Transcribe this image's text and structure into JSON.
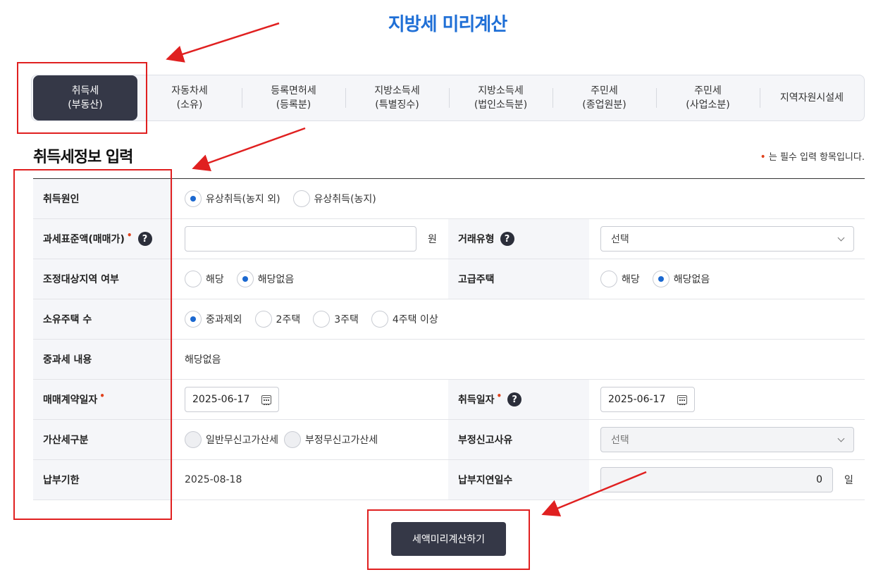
{
  "title": "지방세 미리계산",
  "tabs": [
    {
      "line1": "취득세",
      "line2": "(부동산)",
      "active": true
    },
    {
      "line1": "자동차세",
      "line2": "(소유)"
    },
    {
      "line1": "등록면허세",
      "line2": "(등록분)"
    },
    {
      "line1": "지방소득세",
      "line2": "(특별징수)"
    },
    {
      "line1": "지방소득세",
      "line2": "(법인소득분)"
    },
    {
      "line1": "주민세",
      "line2": "(종업원분)"
    },
    {
      "line1": "주민세",
      "line2": "(사업소분)"
    },
    {
      "line1": "지역자원시설세",
      "line2": ""
    }
  ],
  "section": {
    "title": "취득세정보 입력",
    "required_note": "는 필수 입력 항목입니다.",
    "required_mark": "•"
  },
  "form": {
    "cause": {
      "label": "취득원인",
      "options": [
        "유상취득(농지 외)",
        "유상취득(농지)"
      ],
      "selected": 0
    },
    "tax_base": {
      "label": "과세표준액(매매가)",
      "help": "?",
      "value": "",
      "unit": "원"
    },
    "deal_type": {
      "label": "거래유형",
      "help": "?",
      "value": "선택"
    },
    "adjust_area": {
      "label": "조정대상지역 여부",
      "options": [
        "해당",
        "해당없음"
      ],
      "selected": 1
    },
    "luxury": {
      "label": "고급주택",
      "options": [
        "해당",
        "해당없음"
      ],
      "selected": 1
    },
    "houses": {
      "label": "소유주택 수",
      "options": [
        "중과제외",
        "2주택",
        "3주택",
        "4주택 이상"
      ],
      "selected": 0
    },
    "heavy": {
      "label": "중과세 내용",
      "value": "해당없음"
    },
    "contract_date": {
      "label": "매매계약일자",
      "value": "2025-06-17"
    },
    "acq_date": {
      "label": "취득일자",
      "help": "?",
      "value": "2025-06-17"
    },
    "penalty": {
      "label": "가산세구분",
      "options": [
        "일반무신고가산세",
        "부정무신고가산세"
      ]
    },
    "fraud_reason": {
      "label": "부정신고사유",
      "value": "선택"
    },
    "due": {
      "label": "납부기한",
      "value": "2025-08-18"
    },
    "late_days": {
      "label": "납부지연일수",
      "value": "0",
      "unit": "일"
    }
  },
  "submit_label": "세액미리계산하기",
  "colors": {
    "accent": "#1f6fd6",
    "dark": "#353847",
    "annotation": "#e02020",
    "required": "#e0421d"
  }
}
